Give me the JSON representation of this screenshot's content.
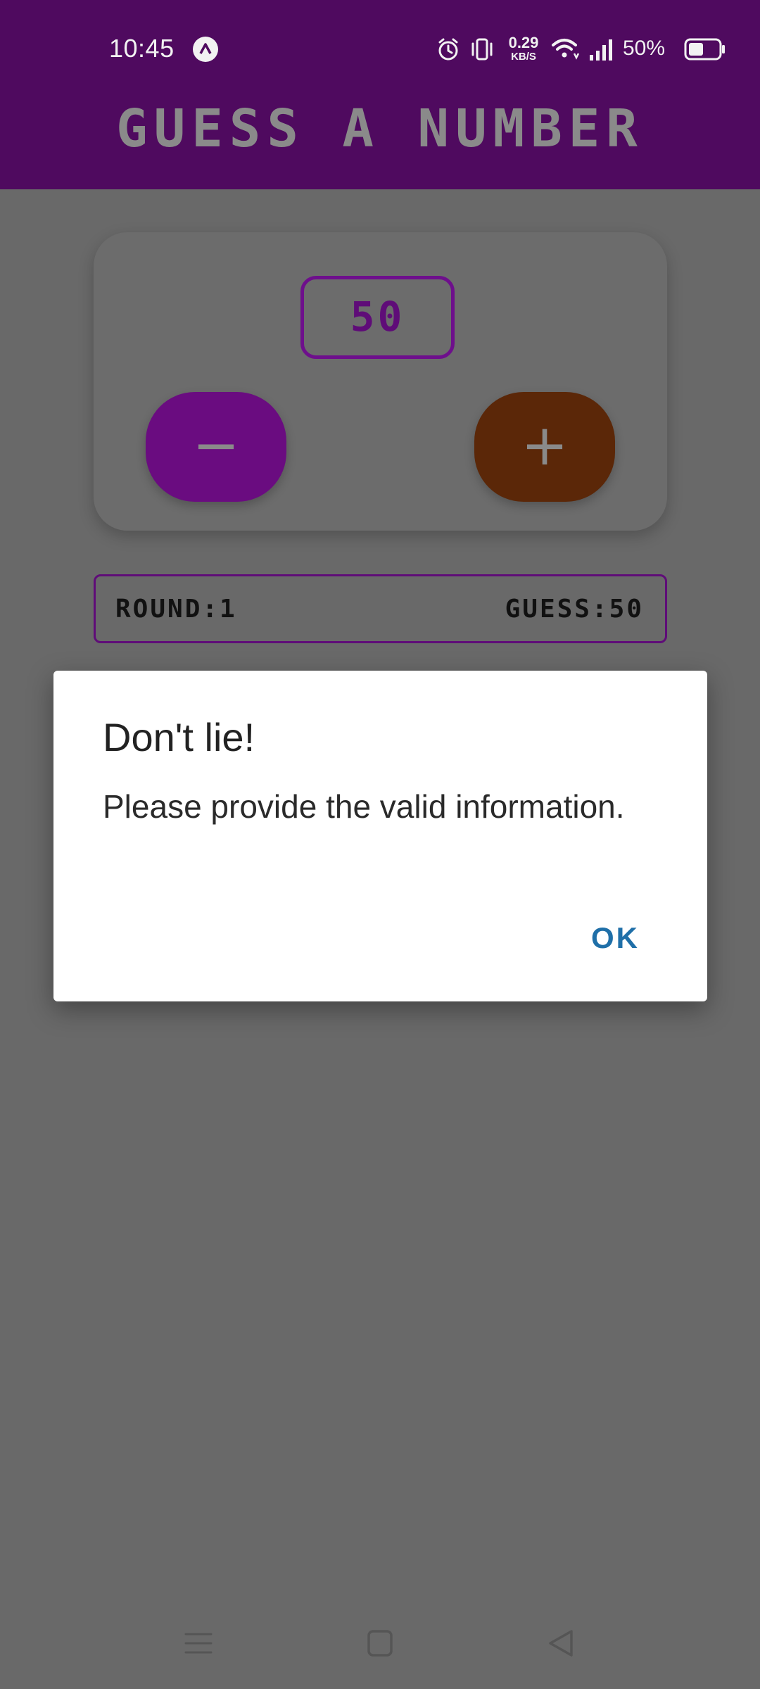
{
  "status_bar": {
    "time": "10:45",
    "network_speed_value": "0.29",
    "network_speed_unit": "KB/S",
    "battery_percent": "50%",
    "battery_level": 0.5,
    "icons": [
      "app-notification-icon",
      "alarm-icon",
      "vibrate-icon",
      "wifi-icon",
      "signal-icon",
      "battery-icon"
    ]
  },
  "header": {
    "title": "GUESS A NUMBER",
    "background_color": "#4f0a5f"
  },
  "game": {
    "current_guess": "50",
    "minus_label": "−",
    "plus_label": "+",
    "minus_color": "#6a0c80",
    "plus_color": "#5b2708"
  },
  "round_info": {
    "round_label": "ROUND:1",
    "guess_label": "GUESS:50"
  },
  "dialog": {
    "title": "Don't lie!",
    "message": "Please provide the valid information.",
    "ok_label": "OK",
    "ok_color": "#1f6fa8"
  },
  "nav_bar": {
    "icons": [
      "menu-icon",
      "home-icon",
      "back-icon"
    ]
  }
}
